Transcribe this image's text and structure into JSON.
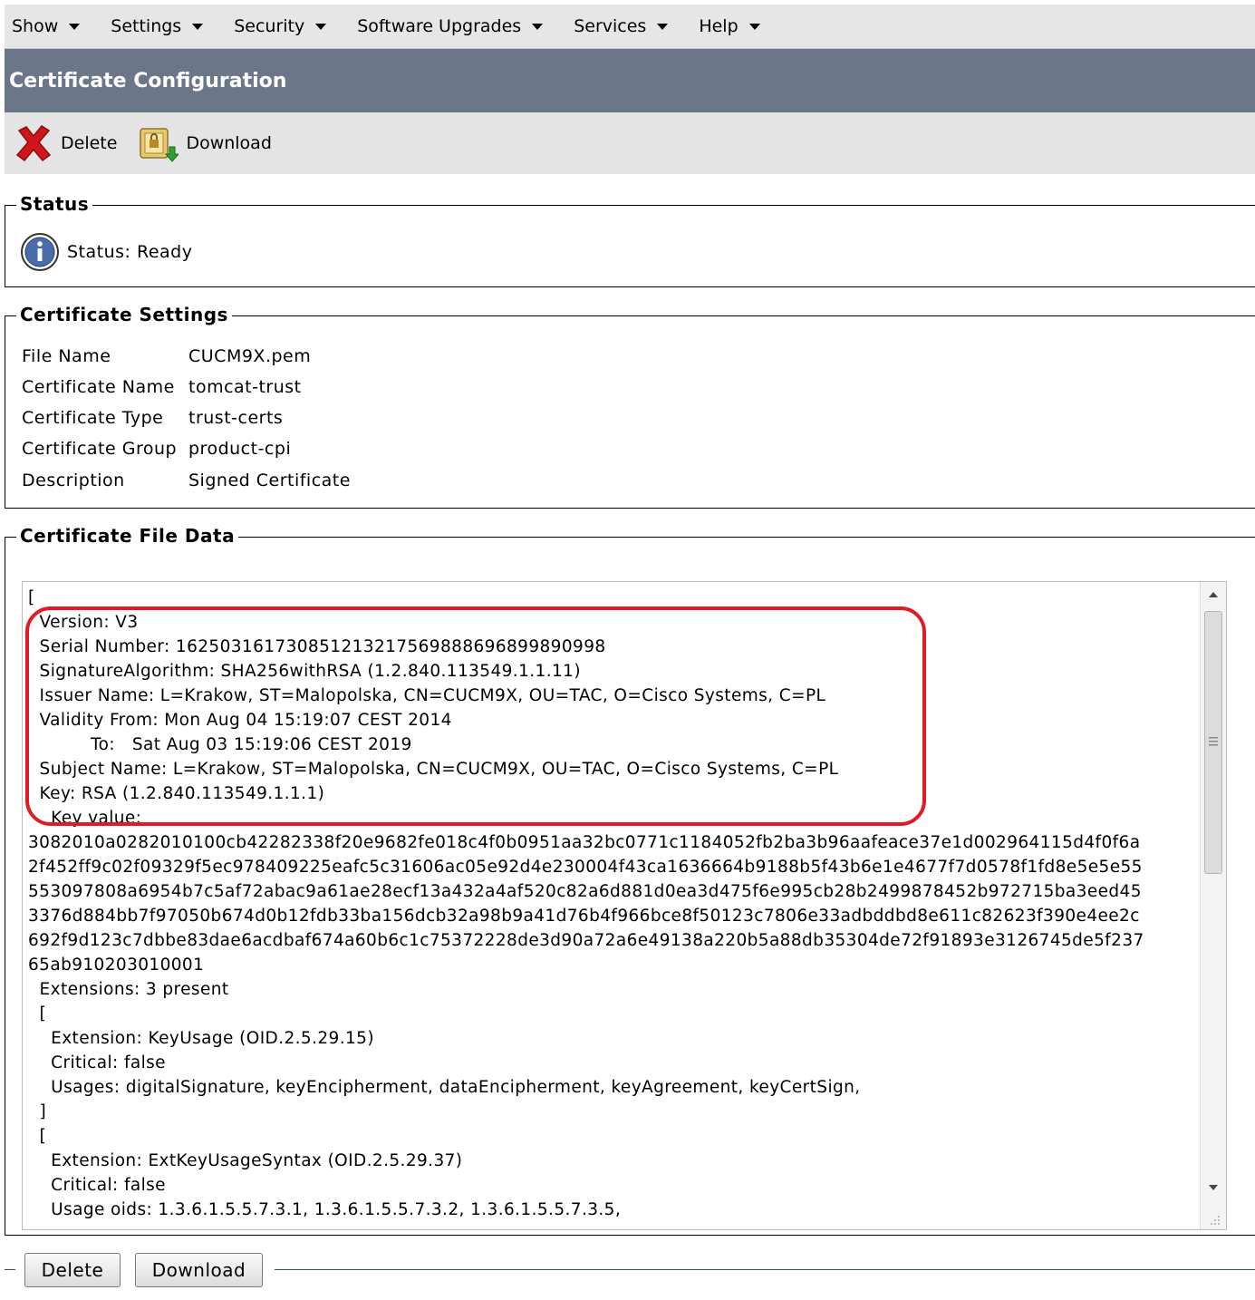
{
  "menu": [
    {
      "label": "Show"
    },
    {
      "label": "Settings"
    },
    {
      "label": "Security"
    },
    {
      "label": "Software Upgrades"
    },
    {
      "label": "Services"
    },
    {
      "label": "Help"
    }
  ],
  "page_title": "Certificate Configuration",
  "toolbar": {
    "delete_label": "Delete",
    "download_label": "Download"
  },
  "status": {
    "legend": "Status",
    "text": "Status: Ready"
  },
  "settings": {
    "legend": "Certificate Settings",
    "rows": [
      {
        "label": "File Name",
        "value": "CUCM9X.pem"
      },
      {
        "label": "Certificate Name",
        "value": "tomcat-trust"
      },
      {
        "label": "Certificate Type",
        "value": "trust-certs"
      },
      {
        "label": "Certificate Group",
        "value": "product-cpi"
      },
      {
        "label": "Description",
        "value": "Signed Certificate"
      }
    ]
  },
  "file_data": {
    "legend": "Certificate File Data",
    "text": "[\n  Version: V3\n  Serial Number: 162503161730851213217569888696899890998\n  SignatureAlgorithm: SHA256withRSA (1.2.840.113549.1.1.11)\n  Issuer Name: L=Krakow, ST=Malopolska, CN=CUCM9X, OU=TAC, O=Cisco Systems, C=PL\n  Validity From: Mon Aug 04 15:19:07 CEST 2014\n           To:   Sat Aug 03 15:19:06 CEST 2019\n  Subject Name: L=Krakow, ST=Malopolska, CN=CUCM9X, OU=TAC, O=Cisco Systems, C=PL\n  Key: RSA (1.2.840.113549.1.1.1)\n    Key value:\n3082010a0282010100cb42282338f20e9682fe018c4f0b0951aa32bc0771c1184052fb2ba3b96aafeace37e1d002964115d4f0f6a\n2f452ff9c02f09329f5ec978409225eafc5c31606ac05e92d4e230004f43ca1636664b9188b5f43b6e1e4677f7d0578f1fd8e5e5e55\n553097808a6954b7c5af72abac9a61ae28ecf13a432a4af520c82a6d881d0ea3d475f6e995cb28b2499878452b972715ba3eed45\n3376d884bb7f97050b674d0b12fdb33ba156dcb32a98b9a41d76b4f966bce8f50123c7806e33adbddbd8e611c82623f390e4ee2c\n692f9d123c7dbbe83dae6acdbaf674a60b6c1c75372228de3d90a72a6e49138a220b5a88db35304de72f91893e3126745de5f237\n65ab910203010001\n  Extensions: 3 present\n  [\n    Extension: KeyUsage (OID.2.5.29.15)\n    Critical: false\n    Usages: digitalSignature, keyEncipherment, dataEncipherment, keyAgreement, keyCertSign,\n  ]\n  [\n    Extension: ExtKeyUsageSyntax (OID.2.5.29.37)\n    Critical: false\n    Usage oids: 1.3.6.1.5.5.7.3.1, 1.3.6.1.5.5.7.3.2, 1.3.6.1.5.5.7.3.5,"
  },
  "bottom": {
    "delete_label": "Delete",
    "download_label": "Download"
  },
  "colors": {
    "title_bar": "#6b7788",
    "highlight": "#e01b24",
    "menu_bg": "#e6e6e6"
  }
}
